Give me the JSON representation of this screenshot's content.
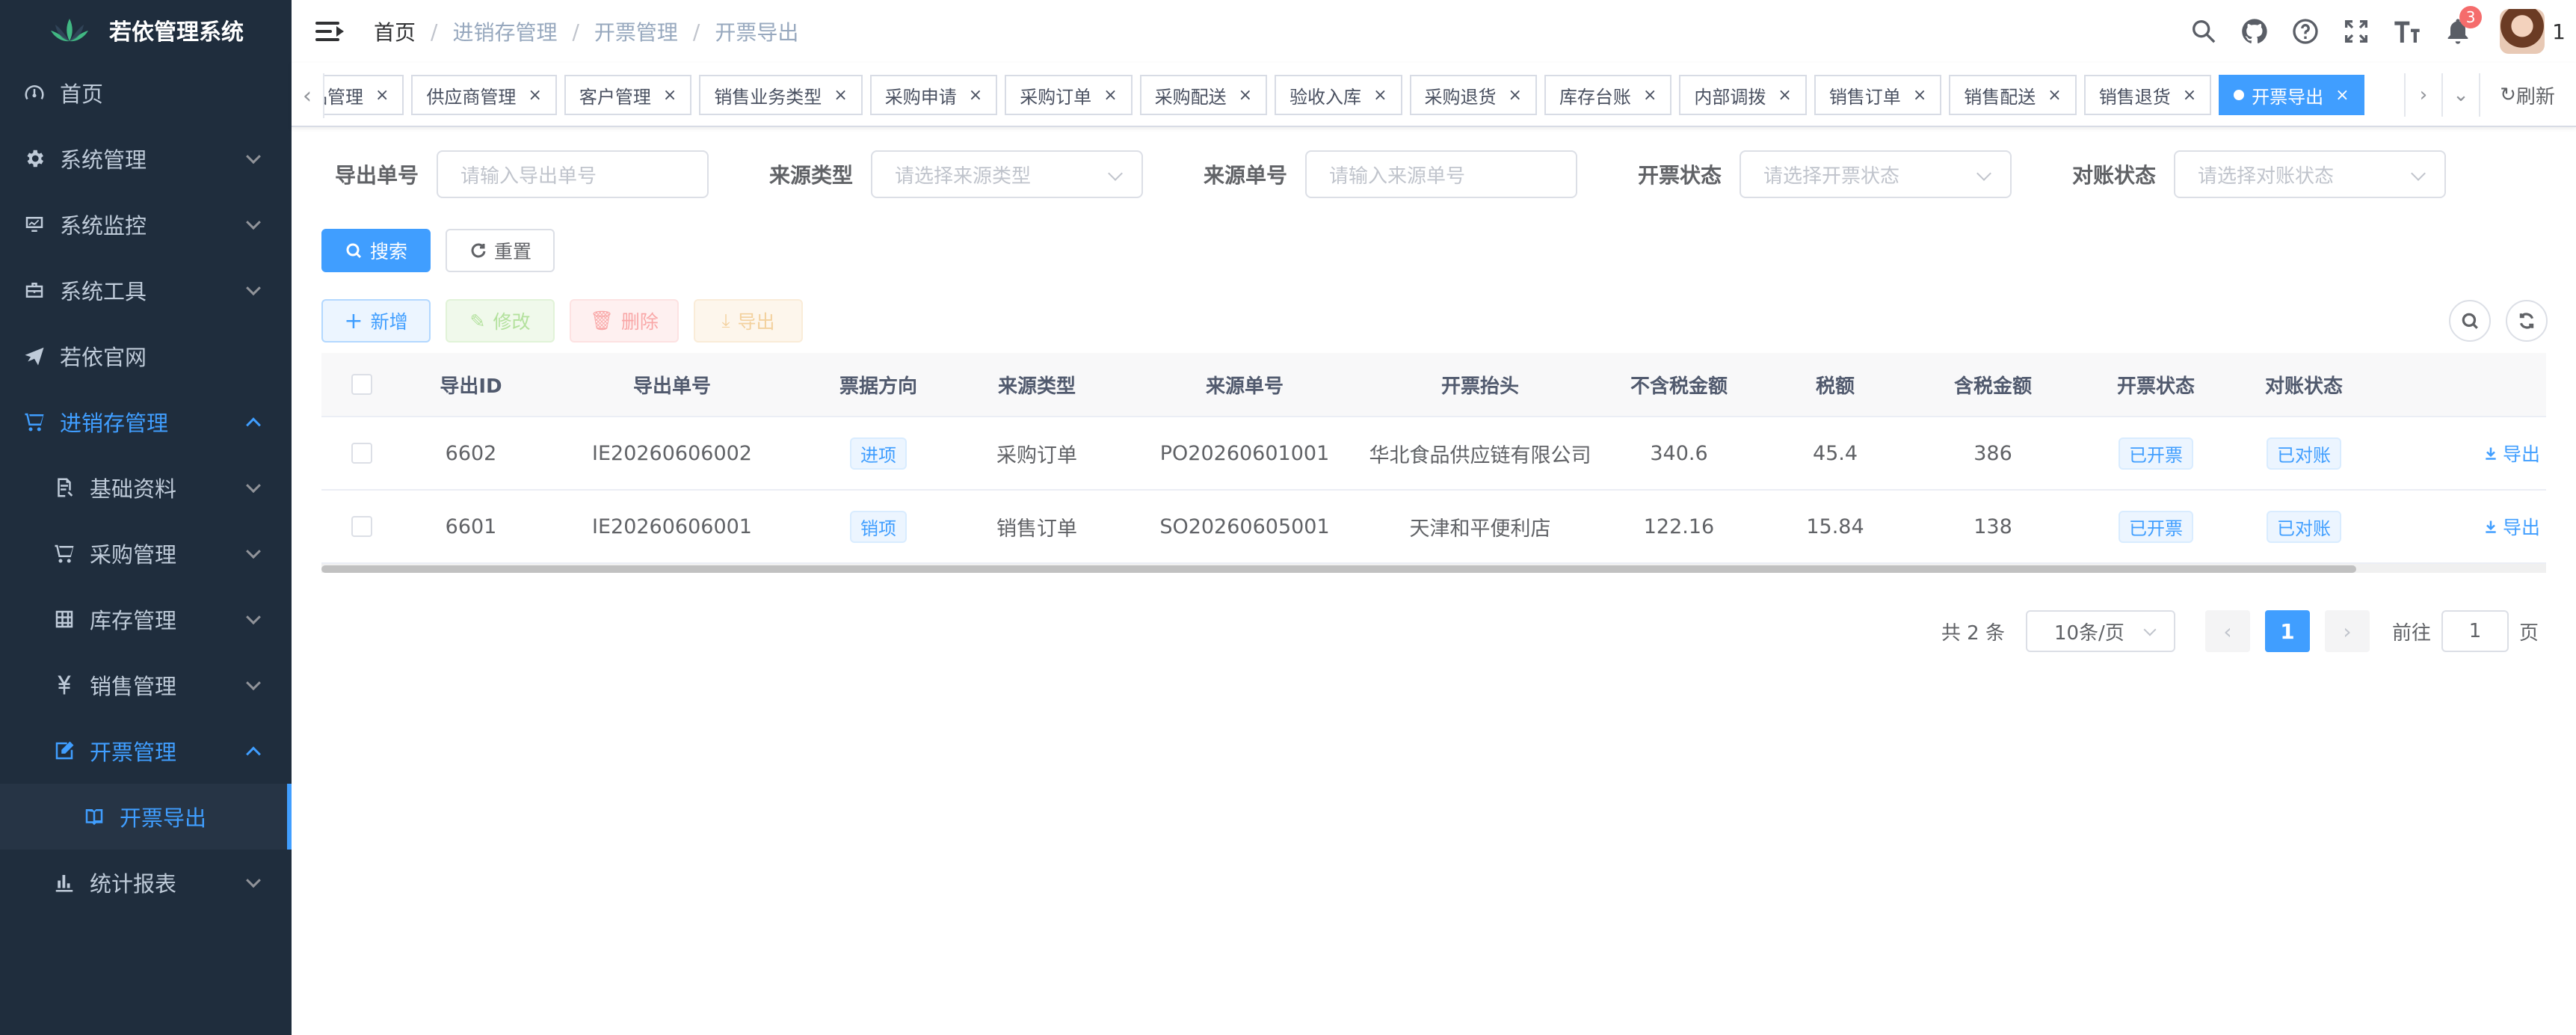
{
  "app": {
    "title": "若依管理系统"
  },
  "sidebar": {
    "items": [
      {
        "label": "首页",
        "icon": "dashboard-icon"
      },
      {
        "label": "系统管理",
        "icon": "gear-icon"
      },
      {
        "label": "系统监控",
        "icon": "monitor-icon"
      },
      {
        "label": "系统工具",
        "icon": "toolbox-icon"
      },
      {
        "label": "若依官网",
        "icon": "paper-plane-icon"
      },
      {
        "label": "进销存管理",
        "icon": "cart-icon"
      }
    ],
    "sub": [
      {
        "label": "基础资料",
        "icon": "document-icon"
      },
      {
        "label": "采购管理",
        "icon": "cart-icon"
      },
      {
        "label": "库存管理",
        "icon": "grid-icon"
      },
      {
        "label": "销售管理",
        "icon": "yen-icon"
      },
      {
        "label": "开票管理",
        "icon": "edit-icon"
      }
    ],
    "leaf": {
      "label": "开票导出",
      "icon": "book-icon"
    },
    "last": {
      "label": "统计报表",
      "icon": "bar-chart-icon"
    }
  },
  "breadcrumb": [
    "首页",
    "进销存管理",
    "开票管理",
    "开票导出"
  ],
  "navbar": {
    "notification_count": "3",
    "user_name": "1"
  },
  "tags": [
    "品管理",
    "供应商管理",
    "客户管理",
    "销售业务类型",
    "采购申请",
    "采购订单",
    "采购配送",
    "验收入库",
    "采购退货",
    "库存台账",
    "内部调拨",
    "销售订单",
    "销售配送",
    "销售退货"
  ],
  "active_tag": "开票导出",
  "tag_refresh": "刷新",
  "search_form": {
    "export_no": {
      "label": "导出单号",
      "placeholder": "请输入导出单号"
    },
    "source_type": {
      "label": "来源类型",
      "placeholder": "请选择来源类型"
    },
    "source_no": {
      "label": "来源单号",
      "placeholder": "请输入来源单号"
    },
    "invoice_status": {
      "label": "开票状态",
      "placeholder": "请选择开票状态"
    },
    "reconcile_status": {
      "label": "对账状态",
      "placeholder": "请选择对账状态"
    },
    "search_label": "搜索",
    "reset_label": "重置"
  },
  "toolbar": {
    "add": "新增",
    "edit": "修改",
    "delete": "删除",
    "export": "导出"
  },
  "table": {
    "headers": [
      "导出ID",
      "导出单号",
      "票据方向",
      "来源类型",
      "来源单号",
      "开票抬头",
      "不含税金额",
      "税额",
      "含税金额",
      "开票状态",
      "对账状态"
    ],
    "rows": [
      {
        "id": "6602",
        "export_no": "IE20260606002",
        "direction": "进项",
        "source_type": "采购订单",
        "source_no": "PO20260601001",
        "title": "华北食品供应链有限公司",
        "amount_ex_tax": "340.6",
        "tax": "45.4",
        "amount_inc_tax": "386",
        "invoice_status": "已开票",
        "reconcile_status": "已对账",
        "op": "导出"
      },
      {
        "id": "6601",
        "export_no": "IE20260606001",
        "direction": "销项",
        "source_type": "销售订单",
        "source_no": "SO20260605001",
        "title": "天津和平便利店",
        "amount_ex_tax": "122.16",
        "tax": "15.84",
        "amount_inc_tax": "138",
        "invoice_status": "已开票",
        "reconcile_status": "已对账",
        "op": "导出"
      }
    ]
  },
  "pagination": {
    "total": "共 2 条",
    "page_size": "10条/页",
    "current": "1",
    "goto_label": "前往",
    "goto_value": "1",
    "page_suffix": "页"
  },
  "colors": {
    "primary": "#409eff",
    "sidebar_bg": "#1f2d3d",
    "danger": "#f56c6c"
  }
}
